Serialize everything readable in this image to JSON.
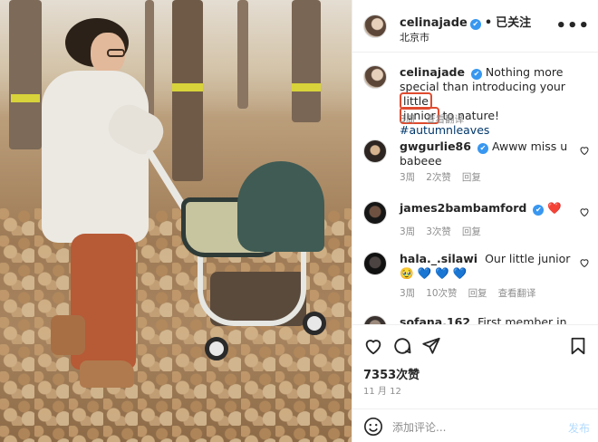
{
  "post": {
    "username": "celinajade",
    "verified_mark": "✔",
    "follow_status": "已关注",
    "location": "北京市",
    "more": "•••"
  },
  "caption": {
    "username": "celinajade",
    "text_before": "Nothing more special than introducing your ",
    "highlight_1": "little",
    "highlight_2": "junior",
    "text_after": " to nature! ",
    "hashtag": "#autumnleaves",
    "time": "3周",
    "translate": "查看翻译"
  },
  "comments": [
    {
      "username": "gwgurlie86",
      "verified": true,
      "text": "Awww miss u babeee",
      "time": "3周",
      "likes": "2次赞",
      "reply": "回复"
    },
    {
      "username": "james2bambamford",
      "verified": true,
      "text": "❤️",
      "time": "3周",
      "likes": "3次赞",
      "reply": "回复"
    },
    {
      "username": "hala._.silawi",
      "verified": false,
      "text": "Our little junior 🥹 💙 💙 💙",
      "time": "3周",
      "likes": "10次赞",
      "reply": "回复",
      "translate": "查看翻译"
    },
    {
      "username": "sofana.162",
      "verified": false,
      "text": "First member in"
    }
  ],
  "actions": {
    "like_icon": "heart-icon",
    "comment_icon": "comment-icon",
    "share_icon": "share-icon",
    "save_icon": "bookmark-icon"
  },
  "likes_count": "7353次赞",
  "date": "11 月 12",
  "add_comment": {
    "placeholder": "添加评论...",
    "post_label": "发布"
  },
  "colors": {
    "verified": "#3897f0",
    "highlight_box": "#e04b2f",
    "hashtag": "#00376b",
    "post_disabled": "#b3dbff"
  }
}
